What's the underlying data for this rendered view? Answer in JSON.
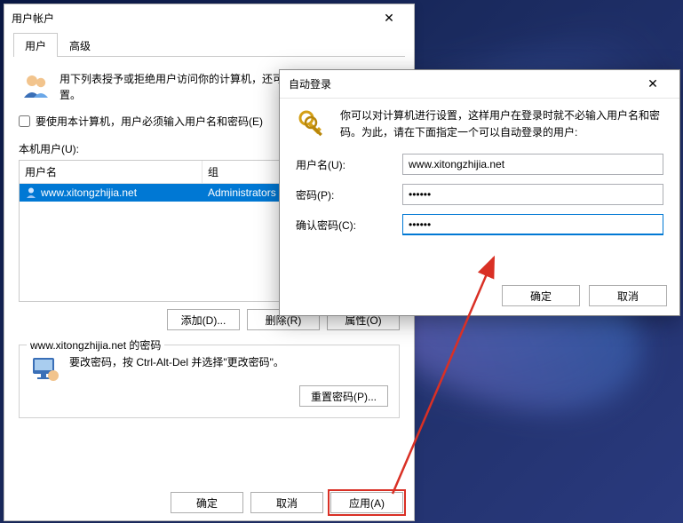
{
  "parent": {
    "title": "用户帐户",
    "tabs": {
      "users": "用户",
      "advanced": "高级"
    },
    "intro": "用下列表授予或拒绝用户访问你的计算机，还可以更改其密码和其他设置。",
    "require_login_label": "要使用本计算机，用户必须输入用户名和密码(E)",
    "list_label": "本机用户(U):",
    "columns": {
      "user": "用户名",
      "group": "组"
    },
    "rows": [
      {
        "name": "www.xitongzhijia.net",
        "group": "Administrators"
      }
    ],
    "buttons": {
      "add": "添加(D)...",
      "remove": "删除(R)",
      "props": "属性(O)"
    },
    "password_box": {
      "title": "www.xitongzhijia.net 的密码",
      "text": "要改密码，按 Ctrl-Alt-Del 并选择\"更改密码\"。",
      "reset": "重置密码(P)..."
    },
    "footer": {
      "ok": "确定",
      "cancel": "取消",
      "apply": "应用(A)"
    }
  },
  "modal": {
    "title": "自动登录",
    "intro": "你可以对计算机进行设置，这样用户在登录时就不必输入用户名和密码。为此，请在下面指定一个可以自动登录的用户:",
    "labels": {
      "username": "用户名(U):",
      "password": "密码(P):",
      "confirm": "确认密码(C):"
    },
    "values": {
      "username": "www.xitongzhijia.net",
      "password": "••••••",
      "confirm": "••••••"
    },
    "footer": {
      "ok": "确定",
      "cancel": "取消"
    }
  },
  "colors": {
    "accent": "#0078d4",
    "highlight": "#d93025"
  }
}
